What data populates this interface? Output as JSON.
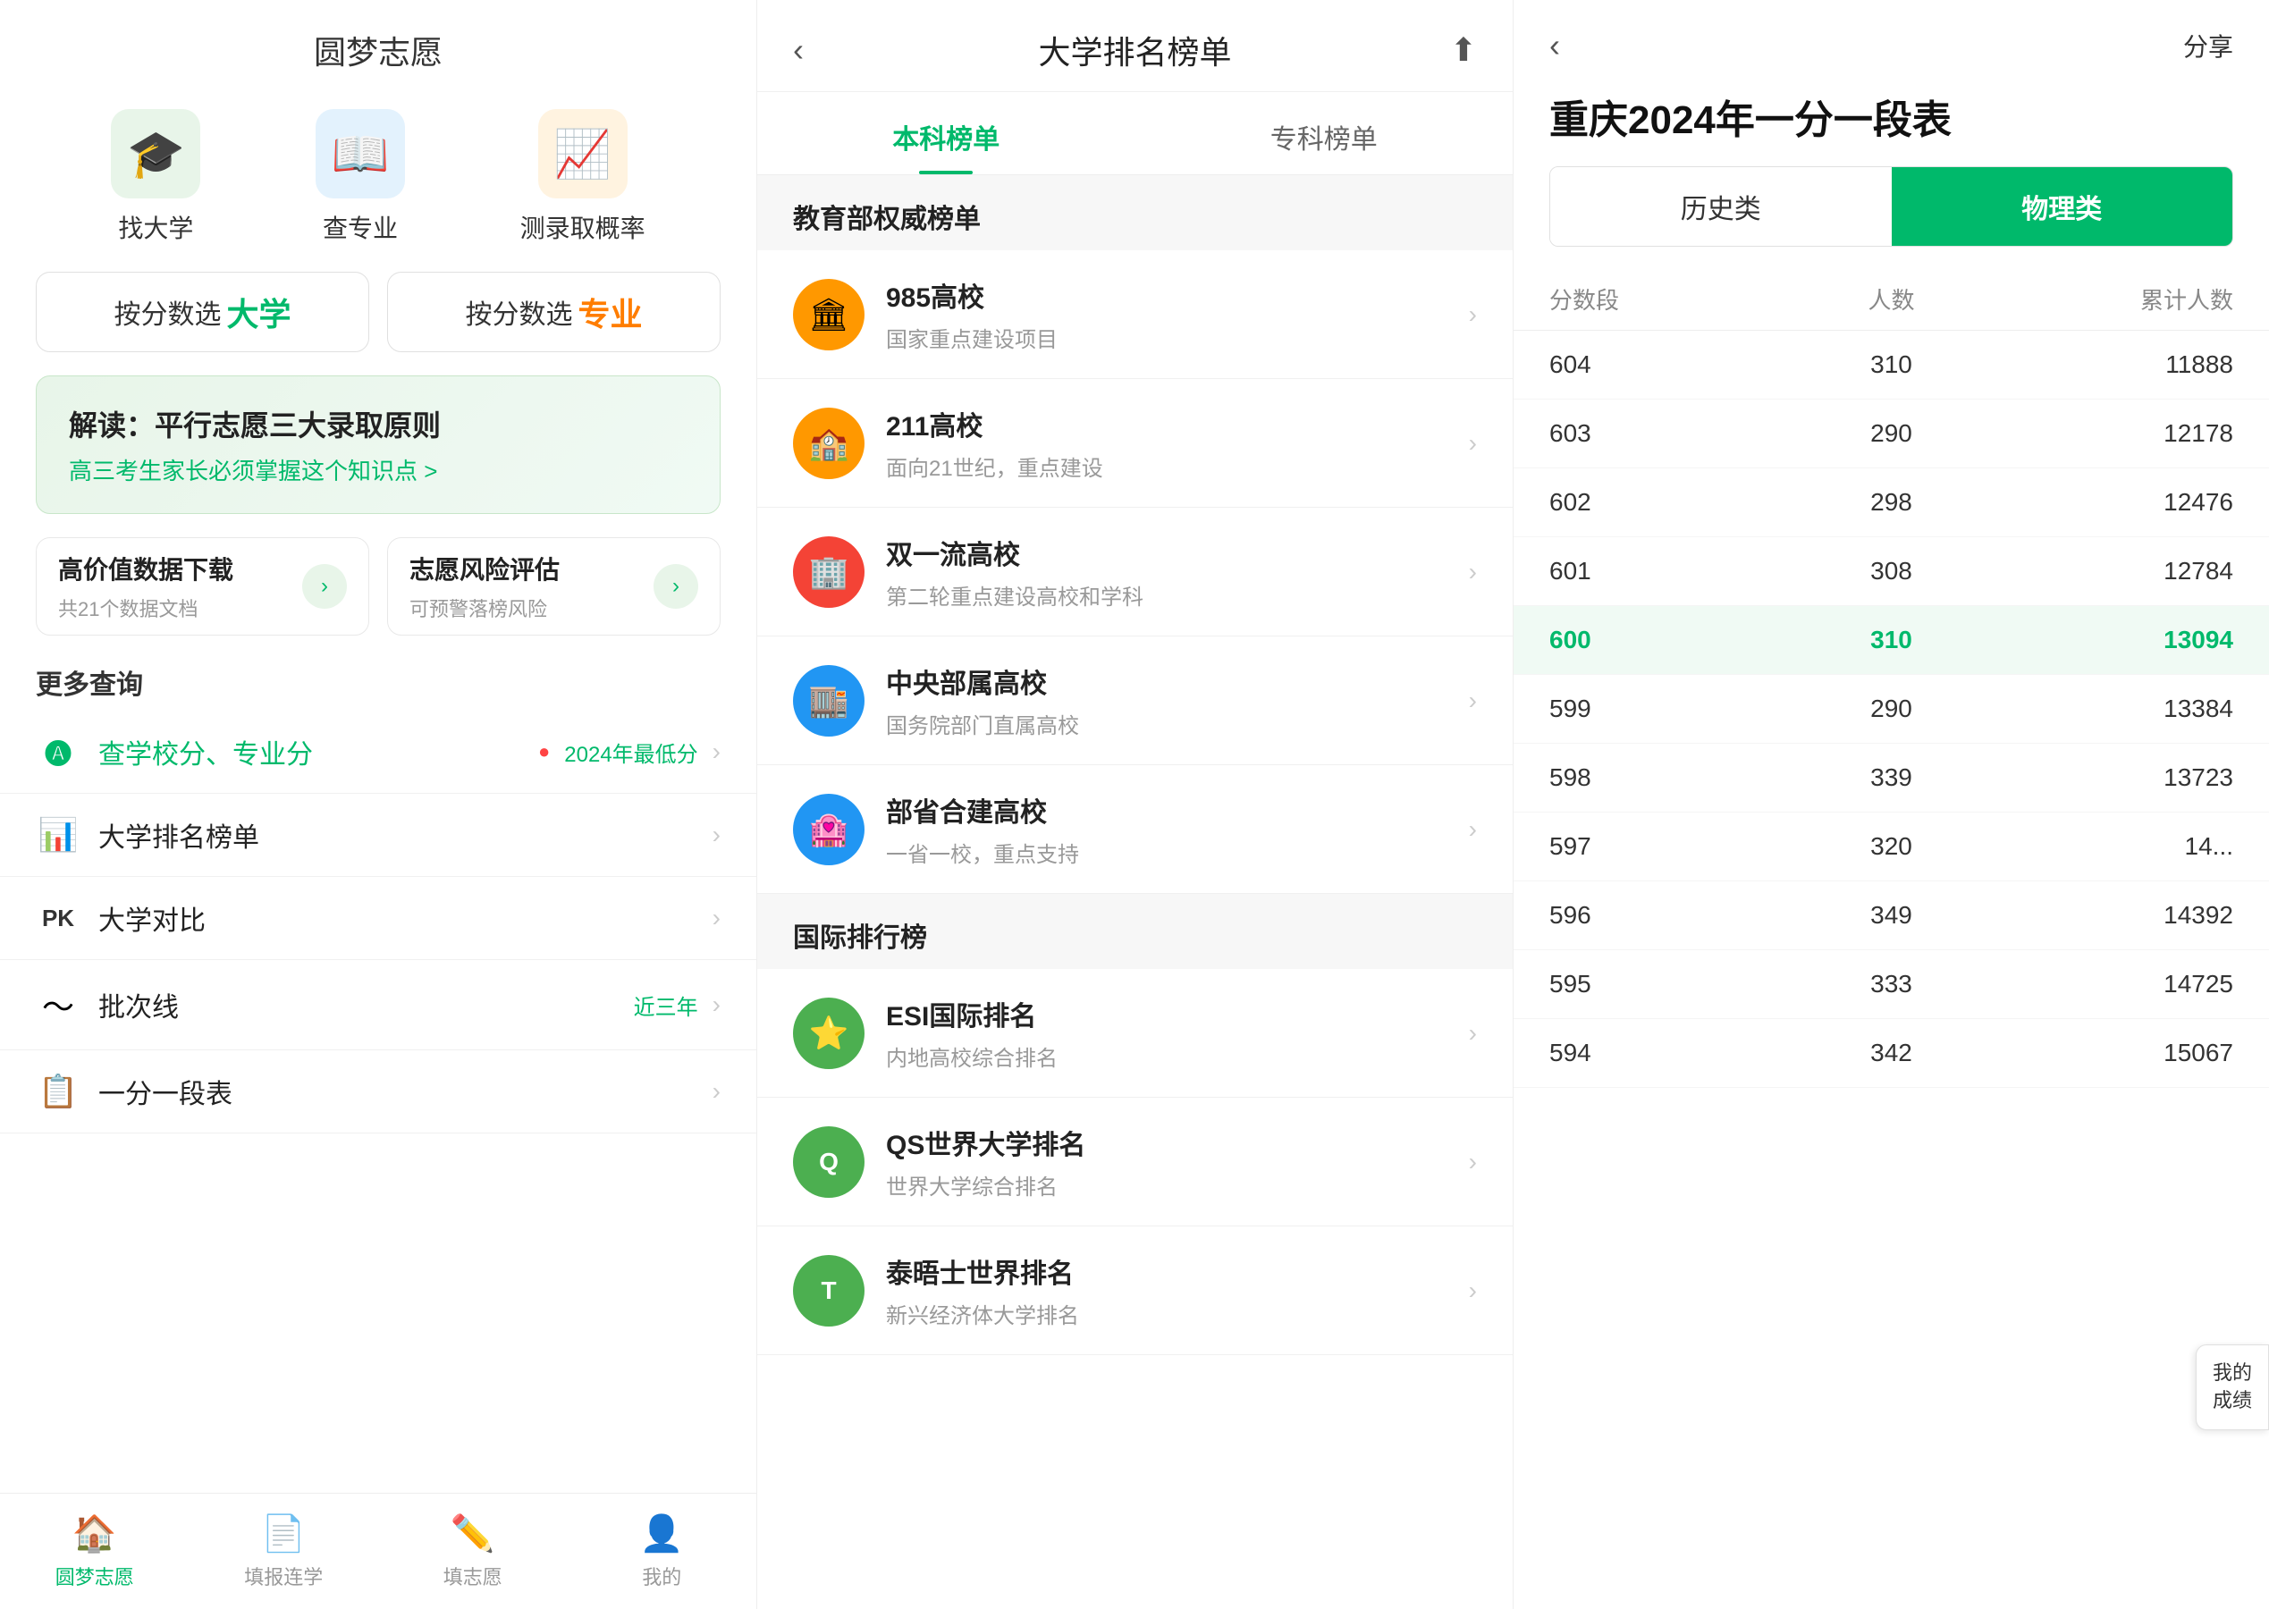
{
  "panel1": {
    "title": "圆梦志愿",
    "icons": [
      {
        "id": "find-university",
        "icon": "🎓",
        "label": "找大学",
        "bg": "#e8f5e9"
      },
      {
        "id": "check-major",
        "icon": "📖",
        "label": "查专业",
        "bg": "#e3f2fd"
      },
      {
        "id": "admission-rate",
        "icon": "📈",
        "label": "测录取概率",
        "bg": "#fff3e0"
      }
    ],
    "select_buttons": [
      {
        "id": "select-university",
        "prefix": "按分数选",
        "highlight": "大学",
        "color": "green"
      },
      {
        "id": "select-major",
        "prefix": "按分数选",
        "highlight": "专业",
        "color": "orange"
      }
    ],
    "banner": {
      "title": "解读：平行志愿三大录取原则",
      "sub": "高三考生家长必须掌握这个知识点 >"
    },
    "data_buttons": [
      {
        "id": "data-download",
        "title": "高价值数据下载",
        "sub": "共21个数据文档"
      },
      {
        "id": "risk-eval",
        "title": "志愿风险评估",
        "sub": "可预警落榜风险"
      }
    ],
    "more_title": "更多查询",
    "list_items": [
      {
        "id": "school-score",
        "icon": "🅐",
        "text": "查学校分、专业分",
        "hint": "2024年最低分",
        "badge": "●",
        "arrow": ">"
      },
      {
        "id": "university-rank",
        "icon": "📊",
        "text": "大学排名榜单",
        "hint": "",
        "badge": "",
        "arrow": ">"
      },
      {
        "id": "university-pk",
        "icon": "PK",
        "text": "大学对比",
        "hint": "",
        "badge": "",
        "arrow": ">"
      },
      {
        "id": "batch-line",
        "icon": "〜",
        "text": "批次线",
        "hint": "近三年",
        "badge": "",
        "arrow": ">"
      },
      {
        "id": "score-segment",
        "icon": "📋",
        "text": "一分一段表",
        "hint": "",
        "badge": "",
        "arrow": ">"
      }
    ],
    "nav": [
      {
        "id": "nav-home",
        "icon": "🏠",
        "label": "圆梦志愿",
        "active": true
      },
      {
        "id": "nav-fill-record",
        "icon": "📄",
        "label": "填报连学",
        "active": false
      },
      {
        "id": "nav-fill",
        "icon": "✏️",
        "label": "填志愿",
        "active": false
      },
      {
        "id": "nav-me",
        "icon": "👤",
        "label": "我的",
        "active": false
      }
    ]
  },
  "panel2": {
    "title": "大学排名榜单",
    "tabs": [
      {
        "id": "tab-undergraduate",
        "label": "本科榜单",
        "active": true
      },
      {
        "id": "tab-college",
        "label": "专科榜单",
        "active": false
      }
    ],
    "sections": [
      {
        "id": "section-edu",
        "title": "教育部权威榜单",
        "items": [
          {
            "id": "985",
            "icon": "🏛",
            "iconBg": "#ff9800",
            "title": "985高校",
            "sub": "国家重点建设项目"
          },
          {
            "id": "211",
            "icon": "🏫",
            "iconBg": "#ff9800",
            "title": "211高校",
            "sub": "面向21世纪，重点建设"
          },
          {
            "id": "shuangyiliu",
            "icon": "🏢",
            "iconBg": "#f44336",
            "title": "双一流高校",
            "sub": "第二轮重点建设高校和学科"
          },
          {
            "id": "central",
            "icon": "🏬",
            "iconBg": "#2196f3",
            "title": "中央部属高校",
            "sub": "国务院部门直属高校"
          },
          {
            "id": "joint",
            "icon": "🏩",
            "iconBg": "#2196f3",
            "title": "部省合建高校",
            "sub": "一省一校，重点支持"
          }
        ]
      },
      {
        "id": "section-intl",
        "title": "国际排行榜",
        "items": [
          {
            "id": "esi",
            "icon": "⭐",
            "iconBg": "#4caf50",
            "title": "ESI国际排名",
            "sub": "内地高校综合排名"
          },
          {
            "id": "qs",
            "icon": "Q",
            "iconBg": "#4caf50",
            "title": "QS世界大学排名",
            "sub": "世界大学综合排名"
          },
          {
            "id": "times",
            "icon": "T",
            "iconBg": "#4caf50",
            "title": "泰晤士世界排名",
            "sub": "新兴经济体大学排名"
          }
        ]
      }
    ]
  },
  "panel3": {
    "title": "重庆2024年一分一段表",
    "share_label": "分享",
    "type_tabs": [
      {
        "id": "tab-history",
        "label": "历史类",
        "active": false
      },
      {
        "id": "tab-physics",
        "label": "物理类",
        "active": true
      }
    ],
    "table_headers": [
      "分数段",
      "人数",
      "累计人数"
    ],
    "table_rows": [
      {
        "score": "604",
        "count": "310",
        "cumulative": "11888",
        "highlighted": false
      },
      {
        "score": "603",
        "count": "290",
        "cumulative": "12178",
        "highlighted": false
      },
      {
        "score": "602",
        "count": "298",
        "cumulative": "12476",
        "highlighted": false
      },
      {
        "score": "601",
        "count": "308",
        "cumulative": "12784",
        "highlighted": false
      },
      {
        "score": "600",
        "count": "310",
        "cumulative": "13094",
        "highlighted": true
      },
      {
        "score": "599",
        "count": "290",
        "cumulative": "13384",
        "highlighted": false
      },
      {
        "score": "598",
        "count": "339",
        "cumulative": "13723",
        "highlighted": false
      },
      {
        "score": "597",
        "count": "320",
        "cumulative": "14...",
        "highlighted": false
      },
      {
        "score": "596",
        "count": "349",
        "cumulative": "14392",
        "highlighted": false
      },
      {
        "score": "595",
        "count": "333",
        "cumulative": "14725",
        "highlighted": false
      },
      {
        "score": "594",
        "count": "342",
        "cumulative": "15067",
        "highlighted": false
      }
    ],
    "floating_btn": "我的\n成绩"
  }
}
